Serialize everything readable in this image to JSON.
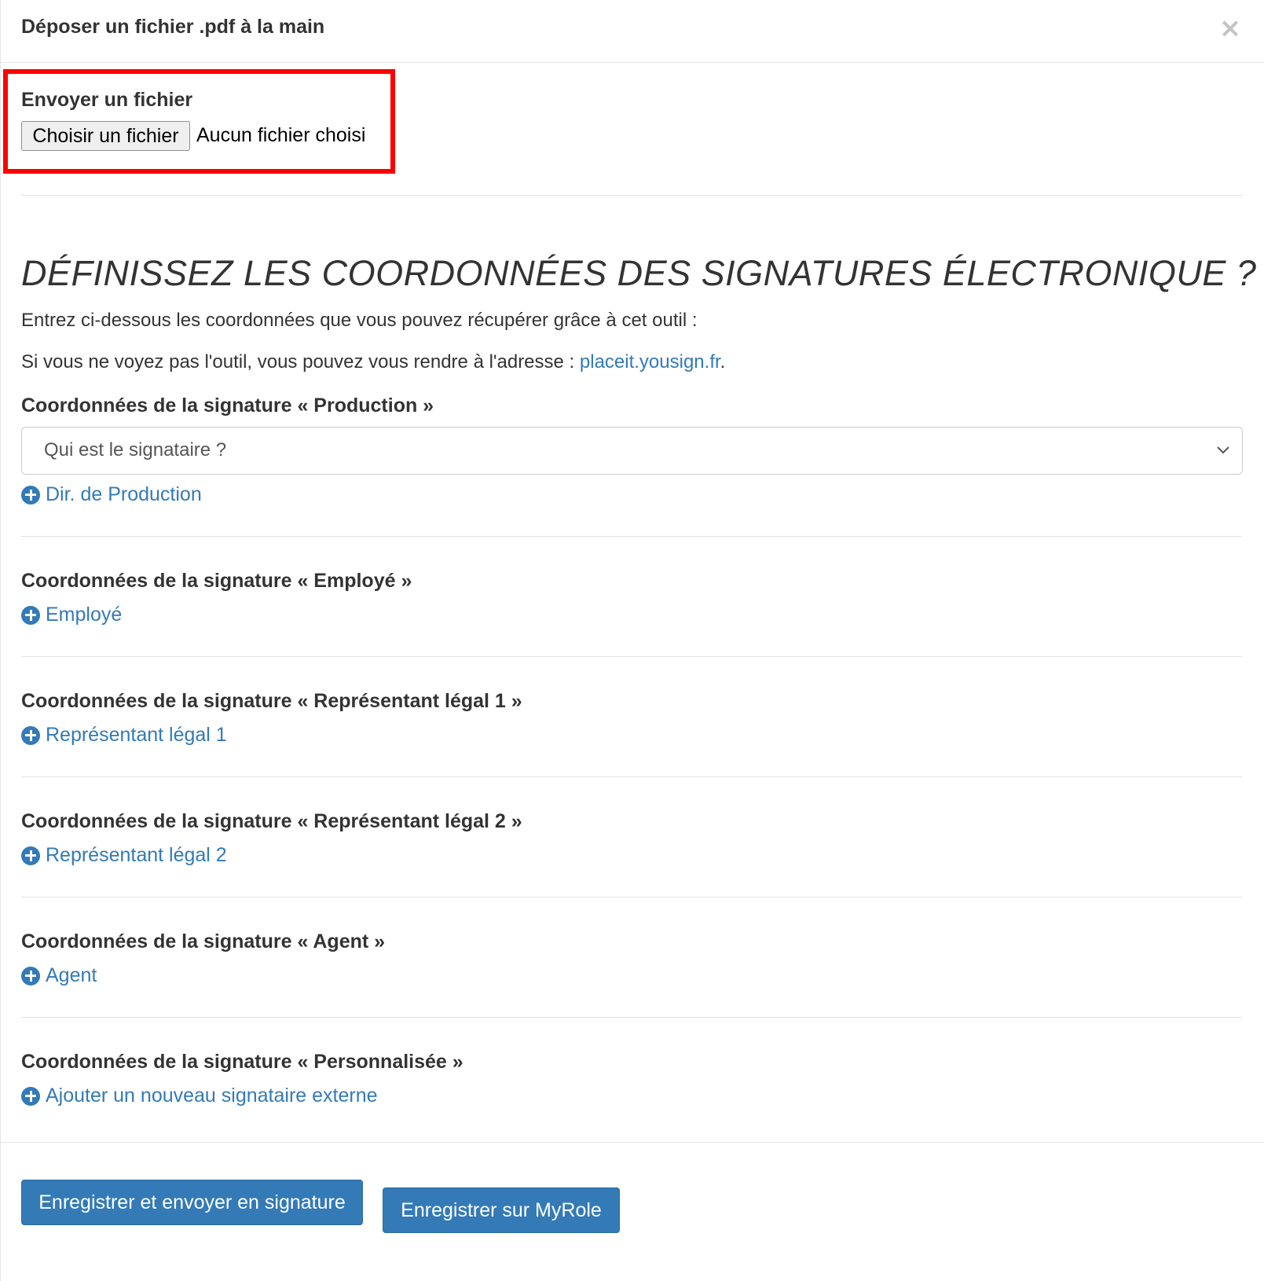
{
  "modal": {
    "title": "Déposer un fichier .pdf à la main",
    "close_label": "×"
  },
  "upload": {
    "label": "Envoyer un fichier",
    "button_label": "Choisir un fichier",
    "status": "Aucun fichier choisi"
  },
  "coordinates": {
    "title": "DÉFINISSEZ LES COORDONNÉES DES SIGNATURES ÉLECTRONIQUE ?",
    "intro": "Entrez ci-dessous les coordonnées que vous pouvez récupérer grâce à cet outil :",
    "tool_text": "Si vous ne voyez pas l'outil, vous pouvez vous rendre à l'adresse : ",
    "tool_link": "placeit.yousign.fr",
    "tool_suffix": "."
  },
  "sections": [
    {
      "label": "Coordonnées de la signature « Production »",
      "select_value": "Qui est le signataire ?",
      "add_label": "Dir. de Production"
    },
    {
      "label": "Coordonnées de la signature « Employé »",
      "add_label": "Employé"
    },
    {
      "label": "Coordonnées de la signature « Représentant légal 1 »",
      "add_label": "Représentant légal 1"
    },
    {
      "label": "Coordonnées de la signature « Représentant légal 2 »",
      "add_label": "Représentant légal 2"
    },
    {
      "label": "Coordonnées de la signature « Agent »",
      "add_label": "Agent"
    },
    {
      "label": "Coordonnées de la signature « Personnalisée »",
      "add_label": "Ajouter un nouveau signataire externe"
    }
  ],
  "footer": {
    "send_label": "Enregistrer et envoyer en signature",
    "save_label": "Enregistrer sur MyRole"
  },
  "colors": {
    "accent": "#337ab7",
    "highlight": "#ff0000"
  }
}
